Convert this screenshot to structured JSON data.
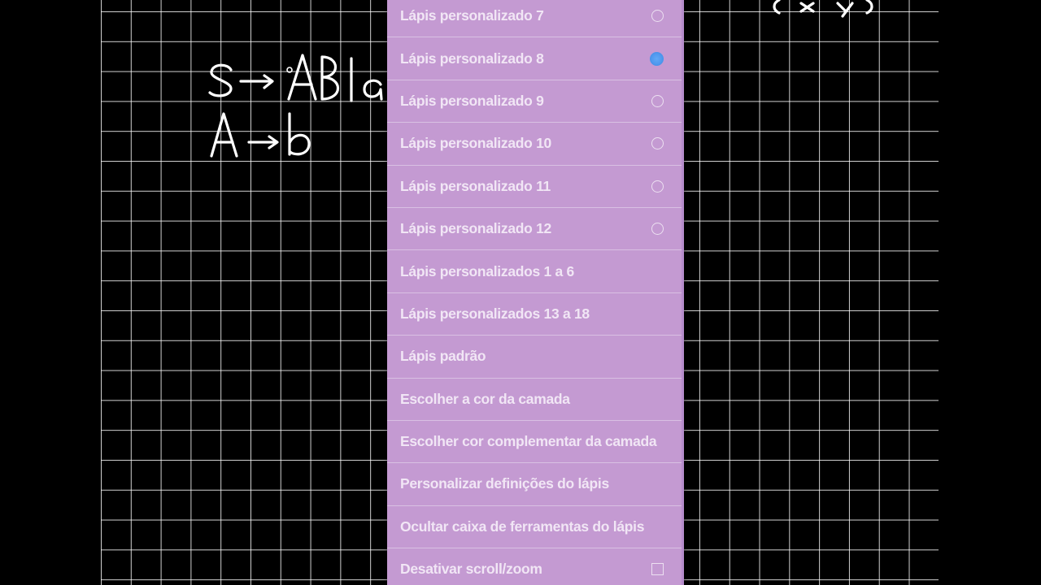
{
  "canvas": {
    "background_color": "#000000",
    "grid_color": "#ffffff",
    "handwriting_color": "#ffffff",
    "handwriting_lines": [
      "S → AB | a",
      "A → b"
    ]
  },
  "menu": {
    "background_color": "#c49ad2",
    "selected_color": "#4f98ee",
    "items": [
      {
        "label": "Lápis personalizado 7",
        "control": "radio",
        "selected": false
      },
      {
        "label": "Lápis personalizado 8",
        "control": "radio",
        "selected": true
      },
      {
        "label": "Lápis personalizado 9",
        "control": "radio",
        "selected": false
      },
      {
        "label": "Lápis personalizado 10",
        "control": "radio",
        "selected": false
      },
      {
        "label": "Lápis personalizado 11",
        "control": "radio",
        "selected": false
      },
      {
        "label": "Lápis personalizado 12",
        "control": "radio",
        "selected": false
      },
      {
        "label": "Lápis personalizados 1 a 6",
        "control": "none"
      },
      {
        "label": "Lápis personalizados 13 a 18",
        "control": "none"
      },
      {
        "label": "Lápis padrão",
        "control": "none"
      },
      {
        "label": "Escolher a cor da camada",
        "control": "none"
      },
      {
        "label": "Escolher cor complementar da camada",
        "control": "none"
      },
      {
        "label": "Personalizar definições do lápis",
        "control": "none"
      },
      {
        "label": "Ocultar caixa de ferramentas do lápis",
        "control": "none"
      },
      {
        "label": "Desativar scroll/zoom",
        "control": "checkbox",
        "checked": false
      }
    ]
  }
}
